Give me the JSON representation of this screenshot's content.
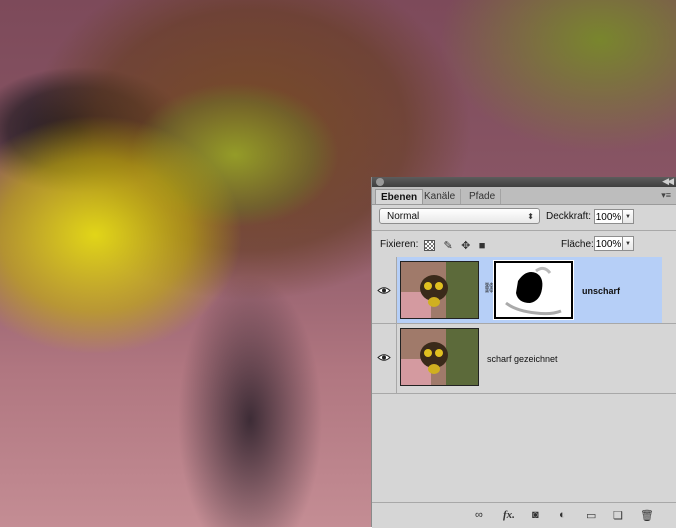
{
  "layers_panel": {
    "tabs": [
      {
        "label": "Ebenen",
        "active": true
      },
      {
        "label": "Kanäle",
        "active": false
      },
      {
        "label": "Pfade",
        "active": false
      }
    ],
    "blend_mode": "Normal",
    "opacity_label": "Deckkraft:",
    "opacity_value": "100%",
    "lock_label": "Fixieren:",
    "fill_label": "Fläche:",
    "fill_value": "100%",
    "layers": [
      {
        "name": "unscharf",
        "selected": true,
        "visible": true,
        "has_mask": true
      },
      {
        "name": "scharf gezeichnet",
        "selected": false,
        "visible": true,
        "has_mask": false
      }
    ],
    "footer_icons": [
      "link-layers-icon",
      "fx-icon",
      "add-mask-icon",
      "adjustment-layer-icon",
      "new-group-icon",
      "new-layer-icon",
      "delete-layer-icon"
    ]
  }
}
